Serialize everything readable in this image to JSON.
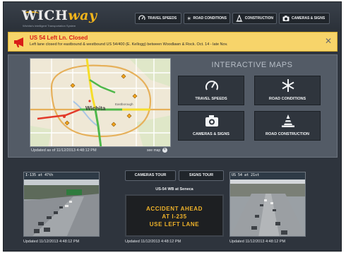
{
  "header": {
    "logo_main": "WICH",
    "logo_accent": "way",
    "logo_tagline": "Wichita's Intelligent Transportation System",
    "nav": [
      {
        "label": "TRAVEL SPEEDS",
        "icon": "speedometer-icon"
      },
      {
        "label": "ROAD CONDITIONS",
        "icon": "snowflake-icon"
      },
      {
        "label": "CONSTRUCTION",
        "icon": "traffic-cone-icon"
      },
      {
        "label": "CAMERAS & SIGNS",
        "icon": "camera-icon"
      }
    ]
  },
  "alert": {
    "title": "US 54 Left Ln. Closed",
    "message": "Left lane closed for eastbound & westbound US 54/400 (E. Kellogg) between Woodlawn & Rock. Oct. 14 - late Nov.",
    "close": "✕",
    "colors": {
      "background": "#f7d46a",
      "title": "#d91d17"
    }
  },
  "maps": {
    "city_label": "Wichita",
    "district_label": "Eastborough",
    "updated": "Updated as of 11/12/2013 4:48:12 PM",
    "see_map": "see map",
    "title": "INTERACTIVE MAPS",
    "tiles": [
      {
        "label": "TRAVEL SPEEDS",
        "icon": "speedometer-icon"
      },
      {
        "label": "ROAD CONDITIONS",
        "icon": "snowflake-icon"
      },
      {
        "label": "CAMERAS & SIGNS",
        "icon": "camera-icon"
      },
      {
        "label": "ROAD CONSTRUCTION",
        "icon": "traffic-cone-icon"
      }
    ]
  },
  "cameras": {
    "left": {
      "caption": "I-135 at 47th",
      "updated": "Updated 11/12/2013 4:48:12 PM"
    },
    "right": {
      "caption": "US 54 at 21st",
      "updated": "Updated 11/12/2013 4:48:12 PM"
    }
  },
  "signs": {
    "cameras_tour": "CAMERAS TOUR",
    "signs_tour": "SIGNS TOUR",
    "location": "US-54 WB at Seneca",
    "lines": [
      "ACCIDENT AHEAD",
      "AT I-235",
      "USE LEFT LANE"
    ],
    "updated": "Updated 11/12/2013 4:48:12 PM",
    "dms_color": "#f0b32a"
  }
}
